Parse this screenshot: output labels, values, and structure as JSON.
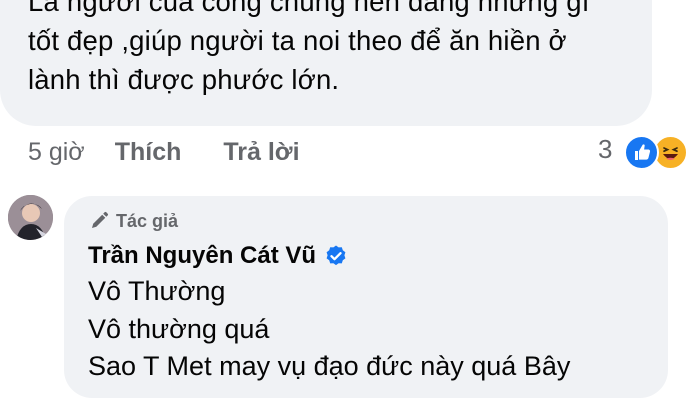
{
  "comment": {
    "lines": [
      "Là người của công chúng nên đăng những gì",
      "tốt đẹp ,giúp người ta noi theo để ăn hiền ở",
      "lành thì được phước lớn."
    ],
    "time": "5 giờ",
    "like_label": "Thích",
    "reply_label": "Trả lời",
    "reaction_count": "3",
    "reaction_icons": [
      "like-icon",
      "haha-icon"
    ]
  },
  "reply": {
    "author_tag": "Tác giả",
    "author_name": "Trần Nguyên Cát Vũ",
    "verified_icon": "verified-badge-icon",
    "lines": [
      "Vô Thường",
      "Vô thường quá",
      "Sao T Met may vụ đạo đức này quá Bây"
    ]
  },
  "colors": {
    "bubble_bg": "#f0f2f5",
    "text": "#050505",
    "secondary_text": "#65676b",
    "like_blue": "#1877f2",
    "haha_yellow": "#f7b125"
  }
}
